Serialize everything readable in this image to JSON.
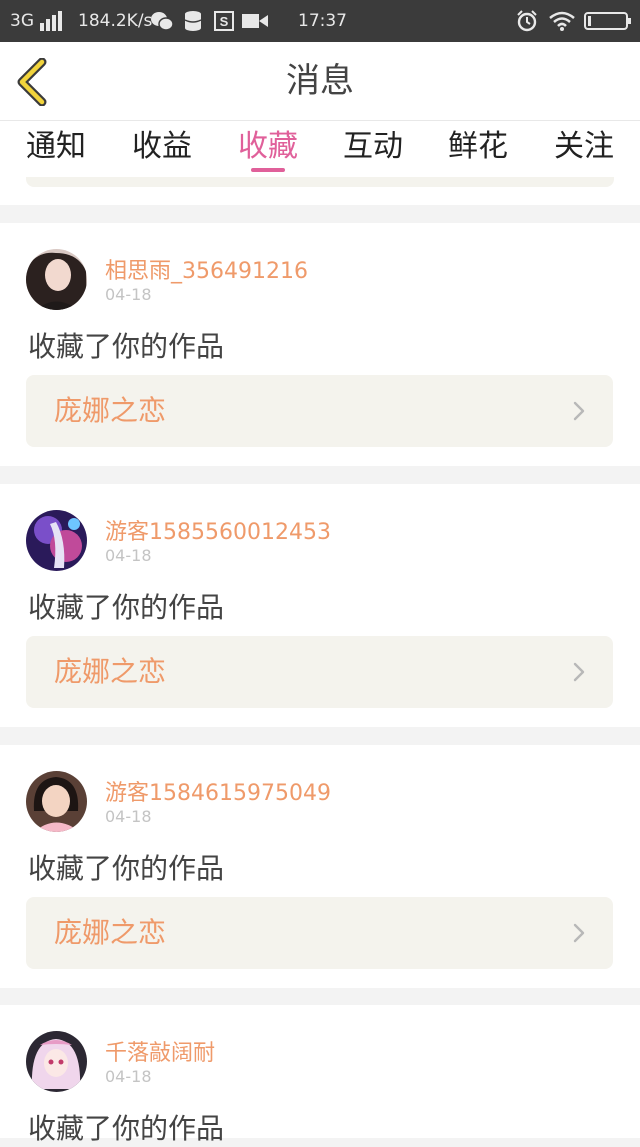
{
  "status_bar": {
    "network": "3G",
    "speed": "184.2K/s",
    "time": "17:37"
  },
  "header": {
    "title": "消息",
    "back_icon": "chevron-left-icon"
  },
  "tabs": [
    {
      "label": "通知",
      "active": false
    },
    {
      "label": "收益",
      "active": false
    },
    {
      "label": "收藏",
      "active": true
    },
    {
      "label": "互动",
      "active": false
    },
    {
      "label": "鲜花",
      "active": false
    },
    {
      "label": "关注",
      "active": false
    }
  ],
  "colors": {
    "accent": "#e0609a",
    "username": "#ef9a6a",
    "link_bg": "#f4f3ed"
  },
  "messages": [
    {
      "username": "相思雨_356491216",
      "date": "04-18",
      "action": "收藏了你的作品",
      "work": "庞娜之恋"
    },
    {
      "username": "游客1585560012453",
      "date": "04-18",
      "action": "收藏了你的作品",
      "work": "庞娜之恋"
    },
    {
      "username": "游客1584615975049",
      "date": "04-18",
      "action": "收藏了你的作品",
      "work": "庞娜之恋"
    },
    {
      "username": "千落敲阔耐",
      "date": "04-18",
      "action": "收藏了你的作品",
      "work": ""
    }
  ]
}
